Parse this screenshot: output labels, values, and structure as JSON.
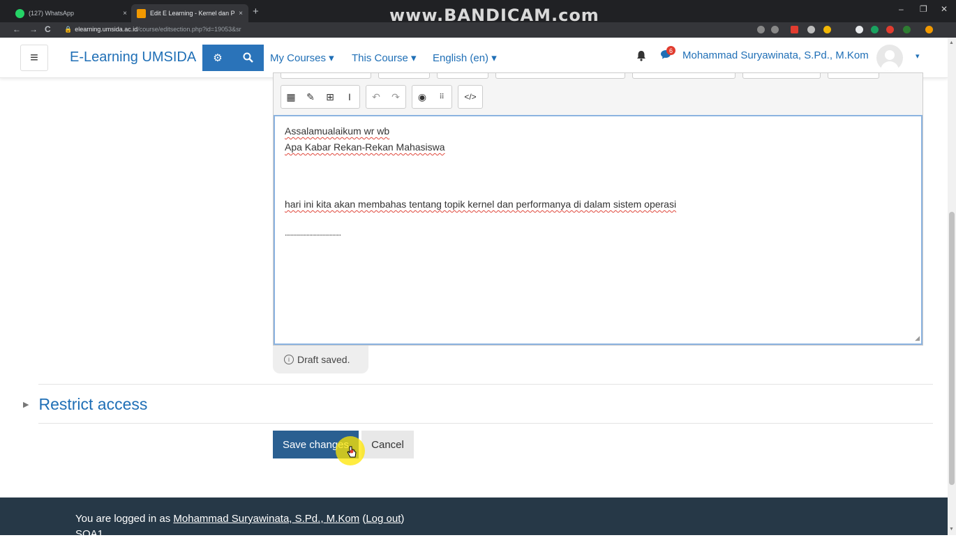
{
  "browser": {
    "tabs": [
      {
        "label": "(127) WhatsApp",
        "close": "×",
        "icon_color": "#25d366"
      },
      {
        "label": "Edit E Learning - Kernel dan Perfo",
        "close": "×",
        "icon_color": "#f29900"
      }
    ],
    "new_tab": "+",
    "watermark": "www.BANDICAM.com",
    "window_controls": {
      "minimize": "–",
      "restore": "❐",
      "close": "✕"
    },
    "nav": {
      "back": "←",
      "forward": "→",
      "reload": "C"
    },
    "url_host": "elearning.umsida.ac.id",
    "url_path": "/course/editsection.php?id=19053&sr"
  },
  "navbar": {
    "menu_icon": "≡",
    "brand": "E-Learning UMSIDA",
    "admin_icon": "⚙",
    "search_icon": "🔍",
    "links": [
      {
        "label": "My Courses ▾"
      },
      {
        "label": "This Course ▾"
      },
      {
        "label": "English (en) ▾"
      }
    ],
    "notification_icon": "🔔",
    "message_icon": "💬",
    "message_count": "6",
    "user_name": "Mohammad Suryawinata, S.Pd., M.Kom",
    "user_caret": "▾"
  },
  "editor": {
    "toolbar": [
      [
        "calendar-icon",
        "edit-icon",
        "table-icon",
        "text-cursor-icon"
      ],
      [
        "undo-icon",
        "redo-icon"
      ],
      [
        "accessibility-icon",
        "braille-icon"
      ],
      [
        "html-icon"
      ]
    ],
    "text": {
      "line1": "Assalamualaikum wr wb",
      "line2": "Apa Kabar Rekan-Rekan Mahasiswa",
      "line3": "hari ini kita akan membahas tentang topik kernel dan performanya di dalam sistem operasi",
      "line4": "......................................."
    },
    "draft_status": "Draft saved."
  },
  "restrict_access": {
    "label": "Restrict access"
  },
  "buttons": {
    "save": "Save changes",
    "cancel": "Cancel"
  },
  "footer": {
    "logged_in_prefix": "You are logged in as ",
    "user_link": "Mohammad Suryawinata, S.Pd., M.Kom",
    "logout_prefix": " (",
    "logout": "Log out",
    "logout_suffix": ")",
    "course_short": "SOA1"
  }
}
